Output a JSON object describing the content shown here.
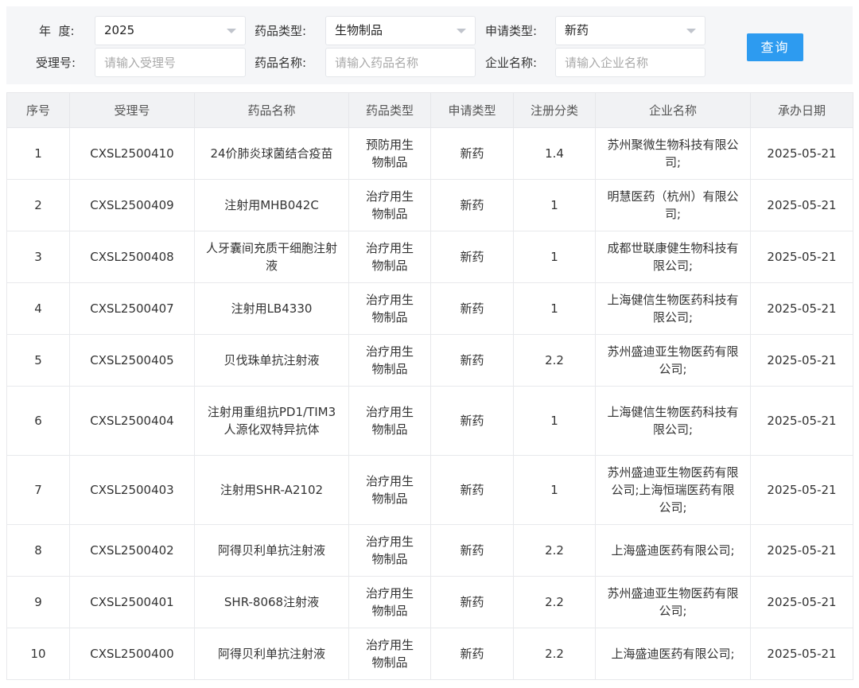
{
  "filters": {
    "year_label": "年  度:",
    "year_value": "2025",
    "drug_type_label": "药品类型:",
    "drug_type_value": "生物制品",
    "apply_type_label": "申请类型:",
    "apply_type_value": "新药",
    "accept_no_label": "受理号:",
    "accept_no_placeholder": "请输入受理号",
    "drug_name_label": "药品名称:",
    "drug_name_placeholder": "请输入药品名称",
    "company_label": "企业名称:",
    "company_placeholder": "请输入企业名称",
    "query_label": "查询"
  },
  "table": {
    "headers": [
      "序号",
      "受理号",
      "药品名称",
      "药品类型",
      "申请类型",
      "注册分类",
      "企业名称",
      "承办日期"
    ],
    "rows": [
      [
        "1",
        "CXSL2500410",
        "24价肺炎球菌结合疫苗",
        "预防用生物制品",
        "新药",
        "1.4",
        "苏州聚微生物科技有限公司;",
        "2025-05-21"
      ],
      [
        "2",
        "CXSL2500409",
        "注射用MHB042C",
        "治疗用生物制品",
        "新药",
        "1",
        "明慧医药（杭州）有限公司;",
        "2025-05-21"
      ],
      [
        "3",
        "CXSL2500408",
        "人牙囊间充质干细胞注射液",
        "治疗用生物制品",
        "新药",
        "1",
        "成都世联康健生物科技有限公司;",
        "2025-05-21"
      ],
      [
        "4",
        "CXSL2500407",
        "注射用LB4330",
        "治疗用生物制品",
        "新药",
        "1",
        "上海健信生物医药科技有限公司;",
        "2025-05-21"
      ],
      [
        "5",
        "CXSL2500405",
        "贝伐珠单抗注射液",
        "治疗用生物制品",
        "新药",
        "2.2",
        "苏州盛迪亚生物医药有限公司;",
        "2025-05-21"
      ],
      [
        "6",
        "CXSL2500404",
        "注射用重组抗PD1/TIM3人源化双特异抗体",
        "治疗用生物制品",
        "新药",
        "1",
        "上海健信生物医药科技有限公司;",
        "2025-05-21"
      ],
      [
        "7",
        "CXSL2500403",
        "注射用SHR-A2102",
        "治疗用生物制品",
        "新药",
        "1",
        "苏州盛迪亚生物医药有限公司;上海恒瑞医药有限公司;",
        "2025-05-21"
      ],
      [
        "8",
        "CXSL2500402",
        "阿得贝利单抗注射液",
        "治疗用生物制品",
        "新药",
        "2.2",
        "上海盛迪医药有限公司;",
        "2025-05-21"
      ],
      [
        "9",
        "CXSL2500401",
        "SHR-8068注射液",
        "治疗用生物制品",
        "新药",
        "2.2",
        "苏州盛迪亚生物医药有限公司;",
        "2025-05-21"
      ],
      [
        "10",
        "CXSL2500400",
        "阿得贝利单抗注射液",
        "治疗用生物制品",
        "新药",
        "2.2",
        "上海盛迪医药有限公司;",
        "2025-05-21"
      ]
    ]
  },
  "icons": {
    "select_caret": "chevron-down-icon"
  },
  "colors": {
    "accent": "#2d9bf0",
    "panel_bg": "#f5f6f8",
    "header_bg": "#f1f2f4"
  }
}
